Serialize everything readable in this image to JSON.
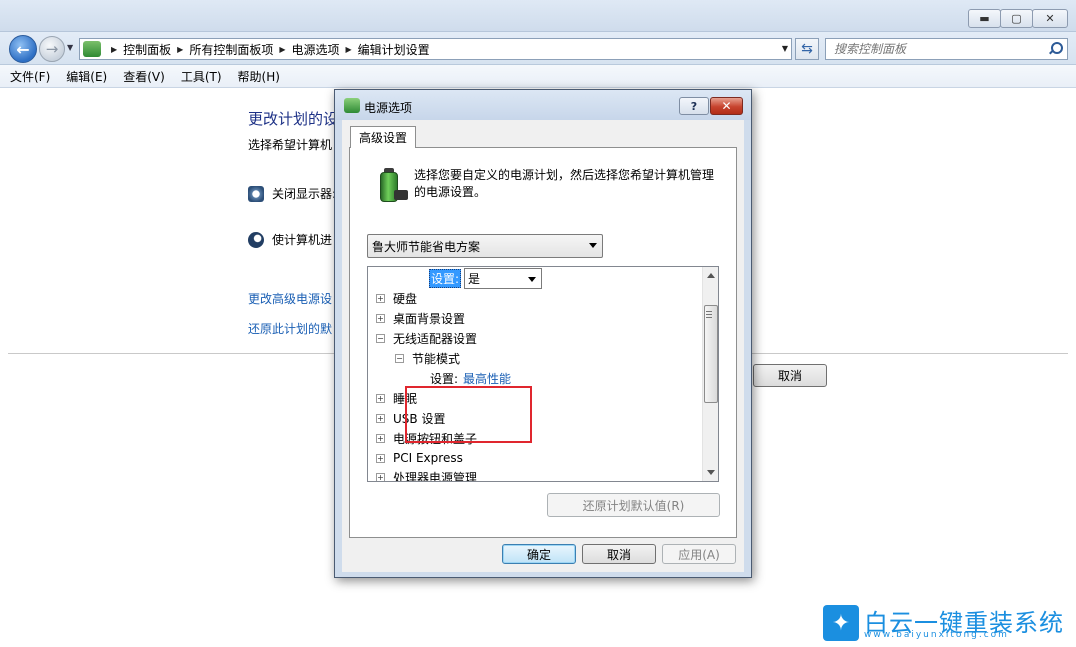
{
  "explorer": {
    "address": {
      "crumbs": [
        "控制面板",
        "所有控制面板项",
        "电源选项",
        "编辑计划设置"
      ]
    },
    "search_placeholder": "搜索控制面板",
    "menu": [
      "文件(F)",
      "编辑(E)",
      "查看(V)",
      "工具(T)",
      "帮助(H)"
    ],
    "content": {
      "title": "更改计划的设",
      "subtitle": "选择希望计算机",
      "row_display": "关闭显示器:",
      "row_sleep": "使计算机进",
      "link_advanced": "更改高级电源设",
      "link_restore": "还原此计划的默",
      "cancel": "取消"
    }
  },
  "dialog": {
    "title": "电源选项",
    "help": "?",
    "close": "✕",
    "tab": "高级设置",
    "intro": "选择您要自定义的电源计划，然后选择您希望计算机管理的电源设置。",
    "plan": "鲁大师节能省电方案",
    "tree": {
      "top_setting_label": "设置:",
      "top_setting_value": "是",
      "items": [
        {
          "label": "硬盘",
          "expander": "+"
        },
        {
          "label": "桌面背景设置",
          "expander": "+"
        },
        {
          "label": "无线适配器设置",
          "expander": "−"
        },
        {
          "label": "节能模式",
          "expander": "−"
        },
        {
          "label": "睡眠",
          "expander": "+"
        },
        {
          "label": "USB 设置",
          "expander": "+"
        },
        {
          "label": "电源按钮和盖子",
          "expander": "+"
        },
        {
          "label": "PCI Express",
          "expander": "+"
        },
        {
          "label": "处理器电源管理",
          "expander": "+"
        }
      ],
      "power_mode_setting_label": "设置:",
      "power_mode_setting_value": "最高性能"
    },
    "restore_defaults": "还原计划默认值(R)",
    "ok": "确定",
    "cancel": "取消",
    "apply": "应用(A)"
  },
  "watermark": {
    "name": "白云一键重装系统",
    "url": "www.baiyunxitong.com"
  }
}
